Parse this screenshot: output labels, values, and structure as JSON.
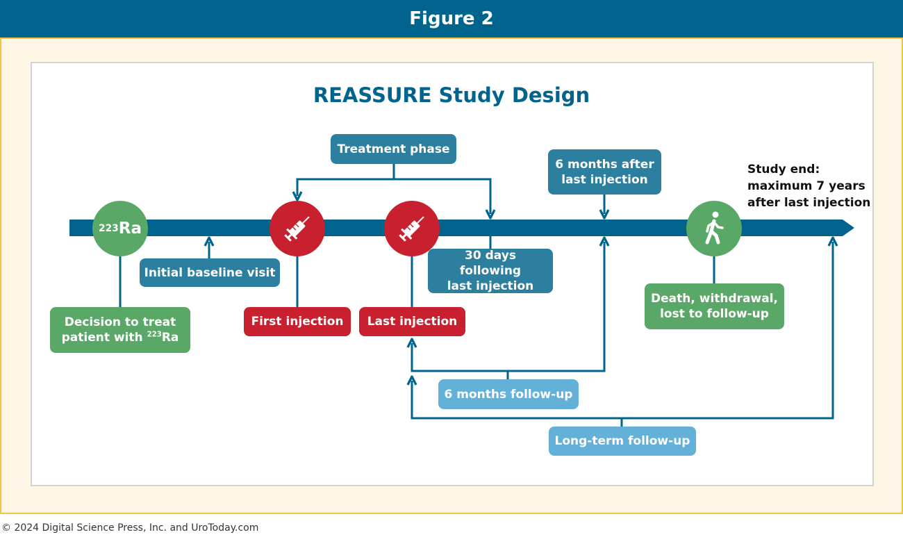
{
  "header": {
    "title": "Figure 2"
  },
  "diagram_title": "REASSURE Study Design",
  "colors": {
    "header_bg": "#00648c",
    "frame_border": "#f4c542",
    "timeline": "#00648c",
    "teal_box": "#2c7f9e",
    "red": "#c8202f",
    "green": "#5aa867",
    "light_blue": "#63b1d8"
  },
  "icons": {
    "ra_marker": "radium-223-circle",
    "first_injection": "syringe-icon",
    "last_injection": "syringe-icon",
    "study_end_marker": "walking-person-icon"
  },
  "ra_marker": {
    "sup": "223",
    "symbol": "Ra"
  },
  "boxes": {
    "treatment_phase": "Treatment phase",
    "initial_baseline": "Initial baseline visit",
    "decision_line1": "Decision to treat",
    "decision_line2_prefix": "patient with ",
    "decision_sup": "223",
    "decision_symbol": "Ra",
    "first_injection": "First injection",
    "last_injection": "Last injection",
    "thirty_days_line1": "30 days following",
    "thirty_days_line2": "last injection",
    "six_months_after_line1": "6 months after",
    "six_months_after_line2": "last injection",
    "death_line1": "Death, withdrawal,",
    "death_line2": "lost to follow-up",
    "six_months_followup": "6 months follow-up",
    "long_term_followup": "Long-term follow-up"
  },
  "study_end": {
    "label": "Study end:",
    "line1": "maximum 7 years",
    "line2": "after last injection"
  },
  "footer": {
    "copyright": "© 2024 Digital Science Press, Inc. and UroToday.com"
  }
}
